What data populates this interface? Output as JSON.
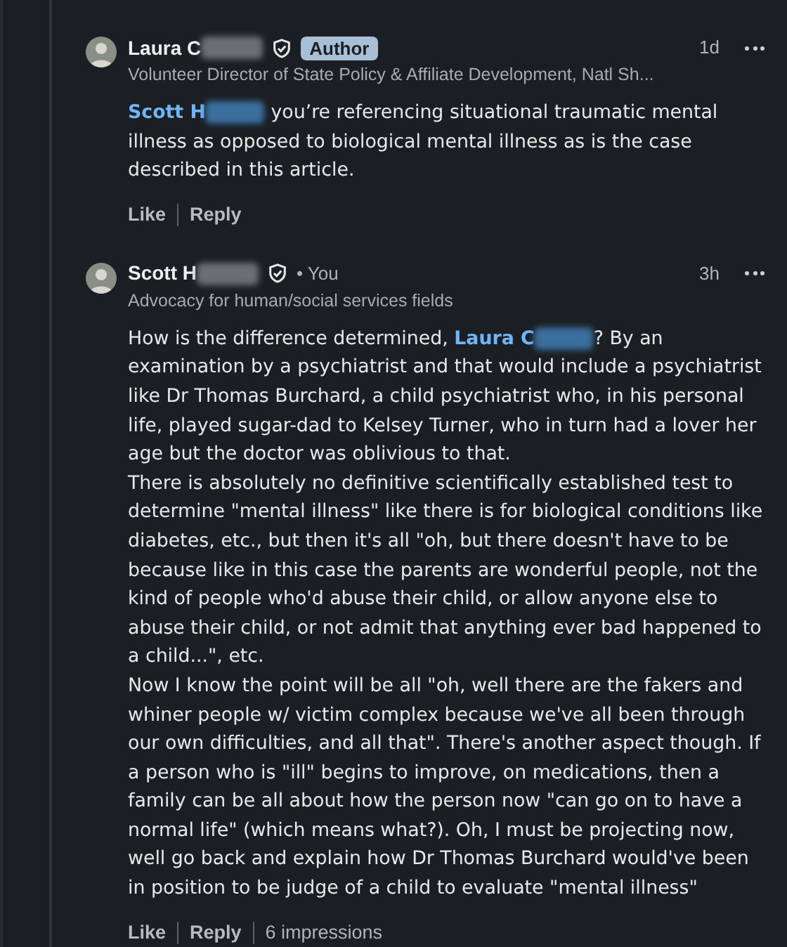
{
  "comments": [
    {
      "author": "Laura C",
      "redacted": true,
      "badge": "Author",
      "you": false,
      "headline": "Volunteer Director of State Policy & Affiliate Development, Natl Sh...",
      "time": "1d",
      "paragraphs": [
        [
          {
            "kind": "mention",
            "text": "Scott H",
            "redacted": true
          },
          {
            "kind": "text",
            "text": " you’re referencing situational traumatic mental illness as opposed to biological mental illness as is the case described in this article."
          }
        ]
      ],
      "actions": [
        "Like",
        "Reply"
      ]
    },
    {
      "author": "Scott H",
      "redacted": true,
      "you": true,
      "you_label": "• You",
      "headline": "Advocacy for human/social services fields",
      "time": "3h",
      "paragraphs": [
        [
          {
            "kind": "text",
            "text": "How is the difference determined, "
          },
          {
            "kind": "mention",
            "text": "Laura C",
            "redacted": true
          },
          {
            "kind": "text",
            "text": "? By an examination by a psychiatrist and that would include a psychiatrist like Dr Thomas Burchard, a child psychiatrist who, in his personal life, played sugar-dad to Kelsey Turner, who in turn had a lover her age but the doctor was oblivious to that."
          }
        ],
        [
          {
            "kind": "text",
            "text": "There is absolutely no definitive scientifically established test to determine \"mental illness\" like there is for biological conditions like diabetes, etc., but then it's all \"oh, but there doesn't have to be because like in this case the parents are wonderful people, not the kind of people who'd abuse their child, or allow anyone else to abuse their child, or not admit that anything ever bad happened to a child...\", etc."
          }
        ],
        [
          {
            "kind": "text",
            "text": "Now I know the point will be all \"oh, well there are the fakers and whiner people w/ victim complex because we've all been through our own difficulties, and all that\". There's another aspect though. If a person who is \"ill\" begins to improve, on medications, then a family can be all about how the person now \"can go on to have a normal life\" (which means what?). Oh, I must be projecting now, well go back and explain how Dr Thomas Burchard would've been in position to be judge of a child to evaluate \"mental illness\""
          }
        ]
      ],
      "actions": [
        "Like",
        "Reply"
      ],
      "impressions": "6 impressions"
    }
  ]
}
